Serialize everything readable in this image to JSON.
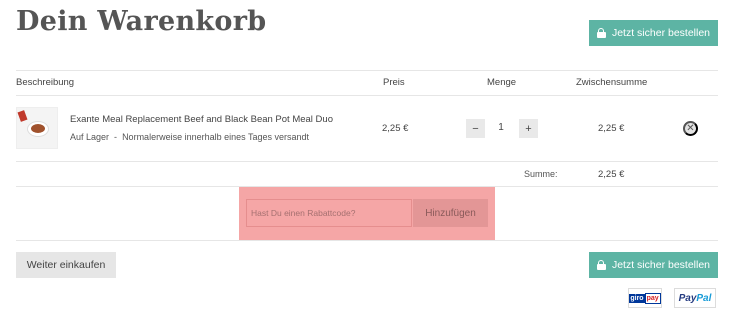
{
  "header": {
    "title": "Dein Warenkorb",
    "checkout_label": "Jetzt sicher bestellen"
  },
  "table": {
    "columns": [
      "Beschreibung",
      "Preis",
      "Menge",
      "Zwischensumme"
    ]
  },
  "item": {
    "name": "Exante Meal Replacement Beef and Black Bean Pot Meal Duo",
    "stock": "Auf Lager",
    "separator": "-",
    "delivery": "Normalerweise innerhalb eines Tages versandt",
    "price": "2,25 €",
    "quantity": "1",
    "minus": "−",
    "plus": "+",
    "subtotal": "2,25 €",
    "remove": "✕"
  },
  "summary": {
    "label": "Summe:",
    "value": "2,25 €"
  },
  "coupon": {
    "placeholder": "Hast Du einen Rabattcode?",
    "button": "Hinzufügen"
  },
  "footer": {
    "continue_label": "Weiter einkaufen",
    "checkout_label": "Jetzt sicher bestellen",
    "payment": {
      "giropay_a": "giro",
      "giropay_b": "pay",
      "paypal_a": "Pay",
      "paypal_b": "Pal"
    }
  },
  "colors": {
    "accent": "#5db4a4",
    "highlight": "#f5a6a6"
  }
}
